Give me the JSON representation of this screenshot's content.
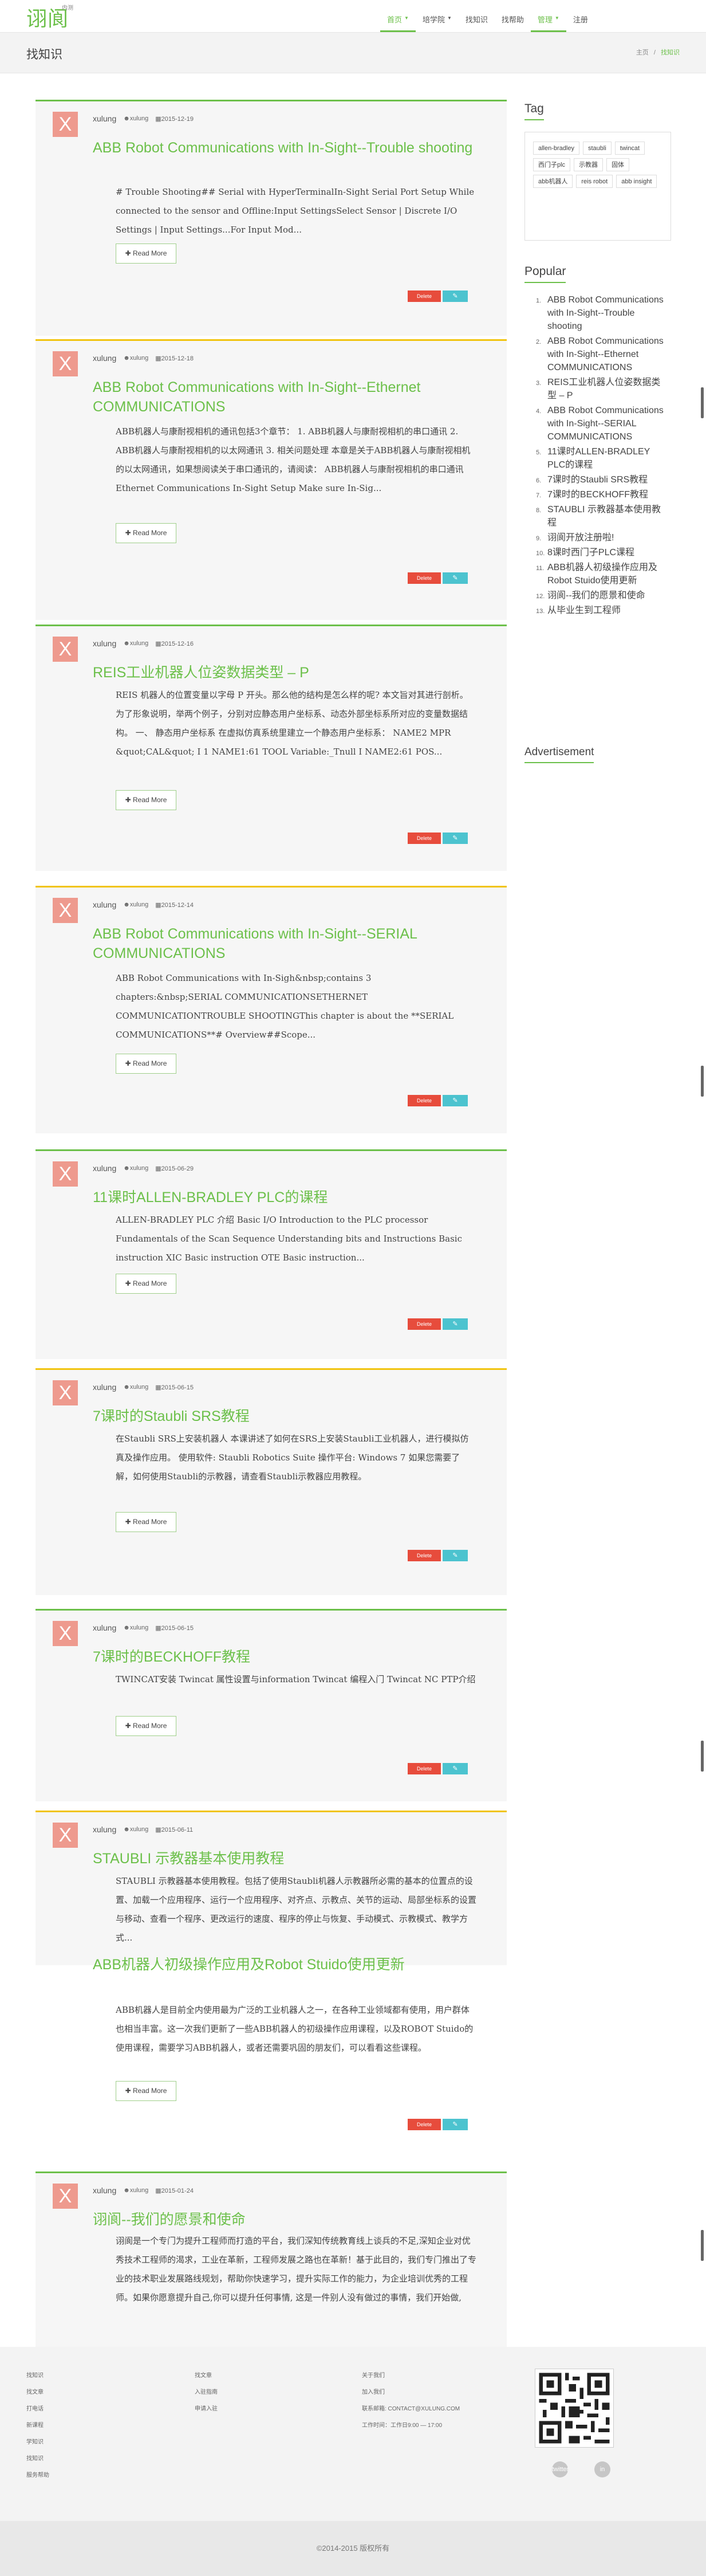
{
  "header": {
    "logo_text": "诩阆",
    "logo_sup": "内测",
    "nav": [
      {
        "label": "首页",
        "dropdown": true,
        "active": true
      },
      {
        "label": "培学院",
        "dropdown": true
      },
      {
        "label": "找知识",
        "dropdown": false
      },
      {
        "label": "找帮助",
        "dropdown": false
      },
      {
        "label": "管理",
        "dropdown": true,
        "active": true
      },
      {
        "label": "注册",
        "dropdown": false
      }
    ]
  },
  "page": {
    "title": "找知识",
    "breadcrumb": {
      "home": "主页",
      "sep": "/",
      "current": "找知识"
    }
  },
  "posts": [
    {
      "user": "xulung",
      "tag": "xulung",
      "date": "2015-12-19",
      "title": "ABB Robot Communications with In-Sight--Trouble shooting",
      "excerpt": "# Trouble Shooting## Serial with HyperTerminalIn-Sight Serial Port Setup While connected to the sensor and Offline:Input SettingsSelect Sensor | Discrete I/O Settings | Input Settings...For Input Mod...",
      "more": "Read More",
      "del": "Delete",
      "edit": "Edit"
    },
    {
      "user": "xulung",
      "tag": "xulung",
      "date": "2015-12-18",
      "title": "ABB Robot Communications with In-Sight--Ethernet COMMUNICATIONS",
      "excerpt": "ABB机器人与康耐视相机的通讯包括3个章节： 1. ABB机器人与康耐视相机的串口通讯 2. ABB机器人与康耐视相机的以太网通讯 3. 相关问题处理 本章是关于ABB机器人与康耐视相机的以太网通讯，如果想阅读关于串口通讯的，请阅读： ABB机器人与康耐视相机的串口通讯 Ethernet Communications In-Sight Setup Make sure In-Sig...",
      "more": "Read More",
      "del": "Delete",
      "edit": "Edit"
    },
    {
      "user": "xulung",
      "tag": "xulung",
      "date": "2015-12-16",
      "title": "REIS工业机器人位姿数据类型 – P",
      "excerpt": "REIS 机器人的位置变量以字母 P 开头。那么他的结构是怎么样的呢? 本文旨对其进行剖析。为了形象说明，举两个例子，分别对应静态用户坐标系、动态外部坐标系所对应的变量数据结构。 一、 静态用户坐标系 在虚拟仿真系统里建立一个静态用户坐标系： NAME2 MPR &quot;CAL&quot; I 1 NAME1:61 TOOL Variable:_Tnull I NAME2:61 POS...",
      "more": "Read More",
      "del": "Delete",
      "edit": "Edit"
    },
    {
      "user": "xulung",
      "tag": "xulung",
      "date": "2015-12-14",
      "title": "ABB Robot Communications with In-Sight--SERIAL COMMUNICATIONS",
      "excerpt": "ABB Robot Communications with In-Sigh&nbsp;contains 3 chapters:&nbsp;SERIAL COMMUNICATIONSETHERNET COMMUNICATIONTROUBLE SHOOTINGThis chapter is about the **SERIAL COMMUNICATIONS**# Overview##Scope...",
      "more": "Read More",
      "del": "Delete",
      "edit": "Edit"
    },
    {
      "user": "xulung",
      "tag": "xulung",
      "date": "2015-06-29",
      "title": "11课时ALLEN-BRADLEY PLC的课程",
      "excerpt": "ALLEN-BRADLEY PLC 介绍 Basic I/O Introduction to the PLC processor Fundamentals of the Scan Sequence Understanding bits and Instructions Basic instruction XIC Basic instruction OTE Basic instruction...",
      "more": "Read More",
      "del": "Delete",
      "edit": "Edit"
    },
    {
      "user": "xulung",
      "tag": "xulung",
      "date": "2015-06-15",
      "title": "7课时的Staubli SRS教程",
      "excerpt": "在Staubli SRS上安装机器人 本课讲述了如何在SRS上安装Staubli工业机器人，进行模拟仿真及操作应用。 使用软件: Staubli Robotics Suite 操作平台: Windows 7 如果您需要了解，如何使用Staubli的示教器，请查看Staubli示教器应用教程。",
      "more": "Read More",
      "del": "Delete",
      "edit": "Edit"
    },
    {
      "user": "xulung",
      "tag": "xulung",
      "date": "2015-06-15",
      "title": "7课时的BECKHOFF教程",
      "excerpt": "TWINCAT安装 Twincat 属性设置与information Twincat 编程入门 Twincat NC PTP介绍",
      "more": "Read More",
      "del": "Delete",
      "edit": "Edit"
    },
    {
      "user": "xulung",
      "tag": "xulung",
      "date": "2015-06-11",
      "title": "STAUBLI 示教器基本使用教程",
      "excerpt": "STAUBLI 示教器基本使用教程。包括了使用Staubli机器人示教器所必需的基本的位置点的设置、加载一个应用程序、运行一个应用程序、对齐点、示教点、关节的运动、局部坐标系的设置与移动、查看一个程序、更改运行的速度、程序的停止与恢复、手动模式、示教模式、教学方式...",
      "more": "Read More",
      "del": "Delete",
      "edit": "Edit"
    },
    {
      "user": "xulung",
      "tag": "xulung",
      "date": "2015-06-11",
      "title": "ABB机器人初级操作应用及Robot Stuido使用更新",
      "excerpt": "ABB机器人是目前全内使用最为广泛的工业机器人之一，在各种工业领域都有使用，用户群体也相当丰富。这一次我们更新了一些ABB机器人的初级操作应用课程，以及ROBOT Stuido的使用课程，需要学习ABB机器人，或者还需要巩固的朋友们，可以看看这些课程。",
      "more": "Read More",
      "del": "Delete",
      "edit": "Edit"
    },
    {
      "user": "xulung",
      "tag": "xulung",
      "date": "2015-01-24",
      "title": "诩阆--我们的愿景和使命",
      "excerpt": "诩阆是一个专门为提升工程师而打造的平台，我们深知传统教育线上谈兵的不足,深知企业对优秀技术工程师的渴求，工业在革新，工程师发展之路也在革新！基于此目的，我们专门推出了专业的技术职业发展路线规划，帮助你快速学习，提升实际工作的能力，为企业培训优秀的工程师。如果你愿意提升自己,你可以提升任何事情, 这是一件别人没有做过的事情，我们开始做,",
      "more": "Read More",
      "del": "Delete",
      "edit": "Edit"
    }
  ],
  "sidebar": {
    "tag_heading": "Tag",
    "tags": [
      "allen-bradley",
      "staubli",
      "twincat",
      "西门子plc",
      "示教器",
      "固体",
      "abb机器人",
      "reis robot",
      "abb insight"
    ],
    "popular_heading": "Popular",
    "popular": [
      "ABB Robot Communications with In-Sight--Trouble shooting",
      "ABB Robot Communications with In-Sight--Ethernet COMMUNICATIONS",
      "REIS工业机器人位姿数据类型 – P",
      "ABB Robot Communications with In-Sight--SERIAL COMMUNICATIONS",
      "11课时ALLEN-BRADLEY PLC的课程",
      "7课时的Staubli SRS教程",
      "7课时的BECKHOFF教程",
      "STAUBLI 示教器基本使用教程",
      "诩阆开放注册啦!",
      "8课时西门子PLC课程",
      "ABB机器人初级操作应用及Robot Stuido使用更新",
      "诩阆--我们的愿景和使命",
      "从毕业生到工程师"
    ],
    "ad_heading": "Advertisement"
  },
  "footer": {
    "col1": [
      "找知识",
      "找文章",
      "打电话",
      "新课程",
      "学知识",
      "找知识",
      "服务帮助"
    ],
    "col2": [
      "找文章",
      "入驻指南",
      "申请入驻"
    ],
    "col3": [
      "关于我们",
      "加入我们",
      "联系邮箱: CONTACT@XULUNG.COM",
      "工作时间：工作日9:00 — 17:00"
    ],
    "social": [
      "twitter",
      "in"
    ],
    "copyright": "©2014-2015 版权所有"
  }
}
